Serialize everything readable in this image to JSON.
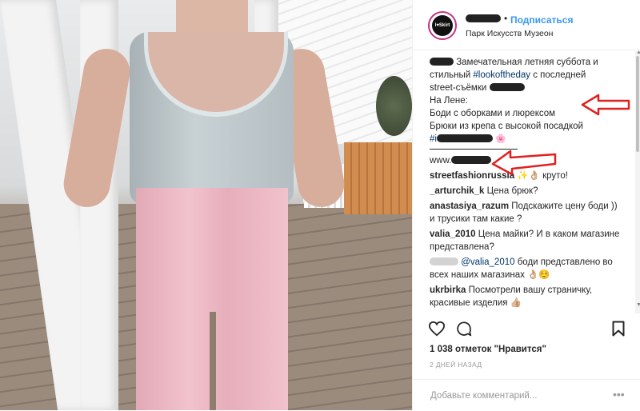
{
  "post": {
    "avatar_text": "I♥Skirt",
    "follow_label": "Подписаться",
    "dot": "•",
    "location": "Парк Искусств Музеон"
  },
  "caption": {
    "line1_a": "Замечательная летняя суббота и",
    "line2_a": "стильный ",
    "hashtag_lookoftheday": "#lookoftheday",
    "line2_b": " с последней",
    "line3_a": "street-съёмки",
    "line4": "На Лене:",
    "line5": "Боди с оборками и люрексом",
    "line6": "Брюки из крепа с высокой посадкой",
    "hashtag_prefix": "#i",
    "flower_emoji": "🌸",
    "www": "www."
  },
  "comments": [
    {
      "user": "streetfashionrussia",
      "text": " ✨👌🏼 круто!"
    },
    {
      "user": "_arturchik_k",
      "text": " Цена брюк?"
    },
    {
      "user": "anastasiya_razum",
      "text": " Подскажите цену боди )) и трусики там какие ?"
    },
    {
      "user": "valia_2010",
      "text": " Цена майки? И в каком магазине представлена?"
    },
    {
      "user": "",
      "mention": "@valia_2010",
      "text": " боди представлено во всех наших магазинах 👌🏼☺️"
    },
    {
      "user": "ukrbirka",
      "text": " Посмотрели вашу страничку, красивые изделия 👍🏼"
    }
  ],
  "likes_text": "1 038 отметок \"Нравится\"",
  "time_text": "2 ДНЕЙ НАЗАД",
  "composer": {
    "placeholder": "Добавьте комментарий...",
    "more": "•••"
  },
  "icons": {
    "like": "heart-icon",
    "comment": "comment-icon",
    "save": "bookmark-icon"
  },
  "colors": {
    "link": "#3897f0",
    "hashtag": "#003569",
    "arrow": "#e02020"
  }
}
